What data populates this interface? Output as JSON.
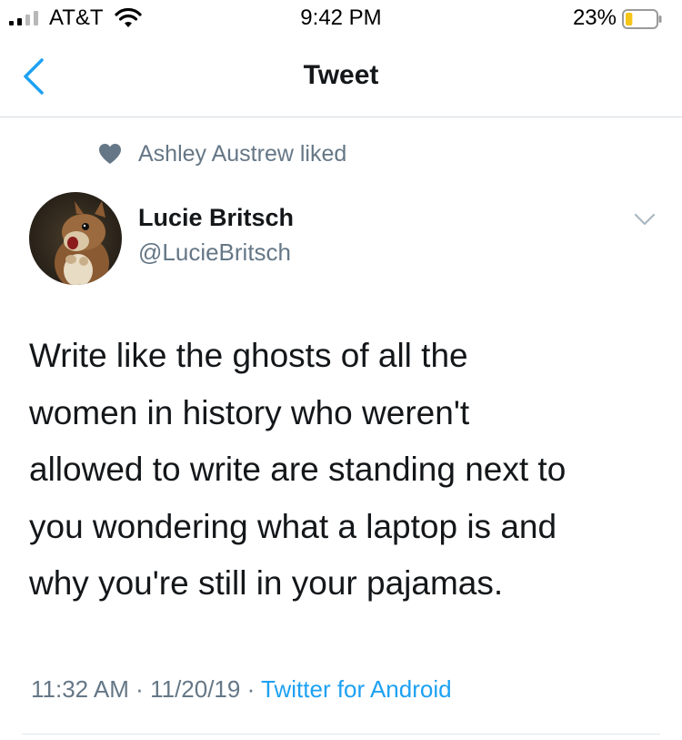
{
  "status_bar": {
    "carrier": "AT&T",
    "time": "9:42 PM",
    "battery_percent": "23%",
    "battery_level": 0.23,
    "icons": [
      "cellular-signal-icon",
      "wifi-icon",
      "battery-icon"
    ]
  },
  "nav": {
    "title": "Tweet",
    "back_icon": "chevron-left-icon"
  },
  "social_context": {
    "icon": "heart-icon",
    "text": "Ashley Austrew liked"
  },
  "author": {
    "name": "Lucie Britsch",
    "handle": "@LucieBritsch",
    "avatar": "squirrel-avatar"
  },
  "tweet": {
    "lines": [
      "Write like the ghosts of all the",
      "women in history who weren't",
      "allowed to write are standing next to",
      "you wondering what a laptop is and",
      "why you're still in your pajamas."
    ]
  },
  "meta": {
    "time": "11:32 AM",
    "date": "11/20/19",
    "separator": "·",
    "source": "Twitter for Android"
  },
  "colors": {
    "primary_text": "#14171a",
    "secondary_text": "#657786",
    "accent": "#1da1f2",
    "battery_low": "#f5c518",
    "divider": "#e1e8ed"
  }
}
